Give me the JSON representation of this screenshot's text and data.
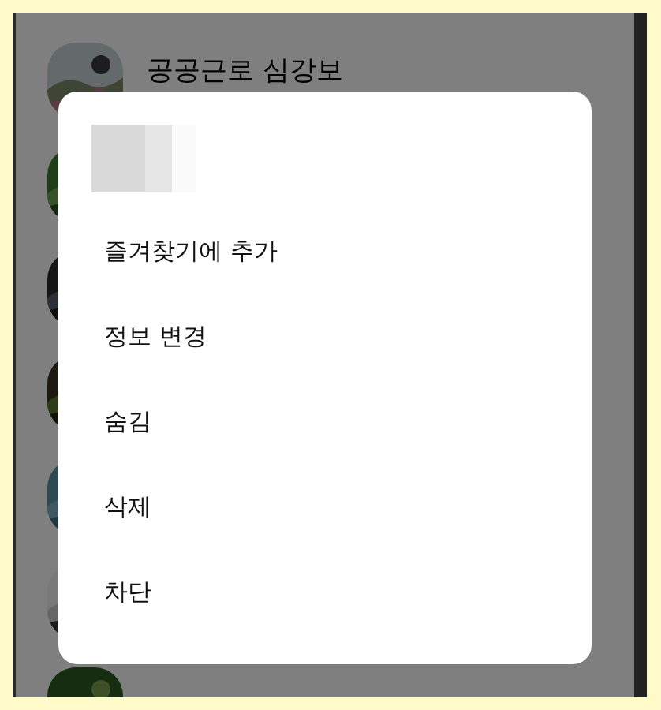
{
  "contacts": [
    {
      "kind": "picture",
      "name": "공공근로 심강보"
    },
    {
      "kind": "picture"
    },
    {
      "kind": "picture"
    },
    {
      "kind": "picture"
    },
    {
      "kind": "picture"
    },
    {
      "kind": "picture"
    },
    {
      "kind": "picture"
    }
  ],
  "dialog": {
    "header": {
      "redacted": true
    },
    "items": [
      {
        "label": "즐겨찾기에 추가"
      },
      {
        "label": "정보 변경"
      },
      {
        "label": "숨김"
      },
      {
        "label": "삭제"
      },
      {
        "label": "차단"
      }
    ]
  }
}
